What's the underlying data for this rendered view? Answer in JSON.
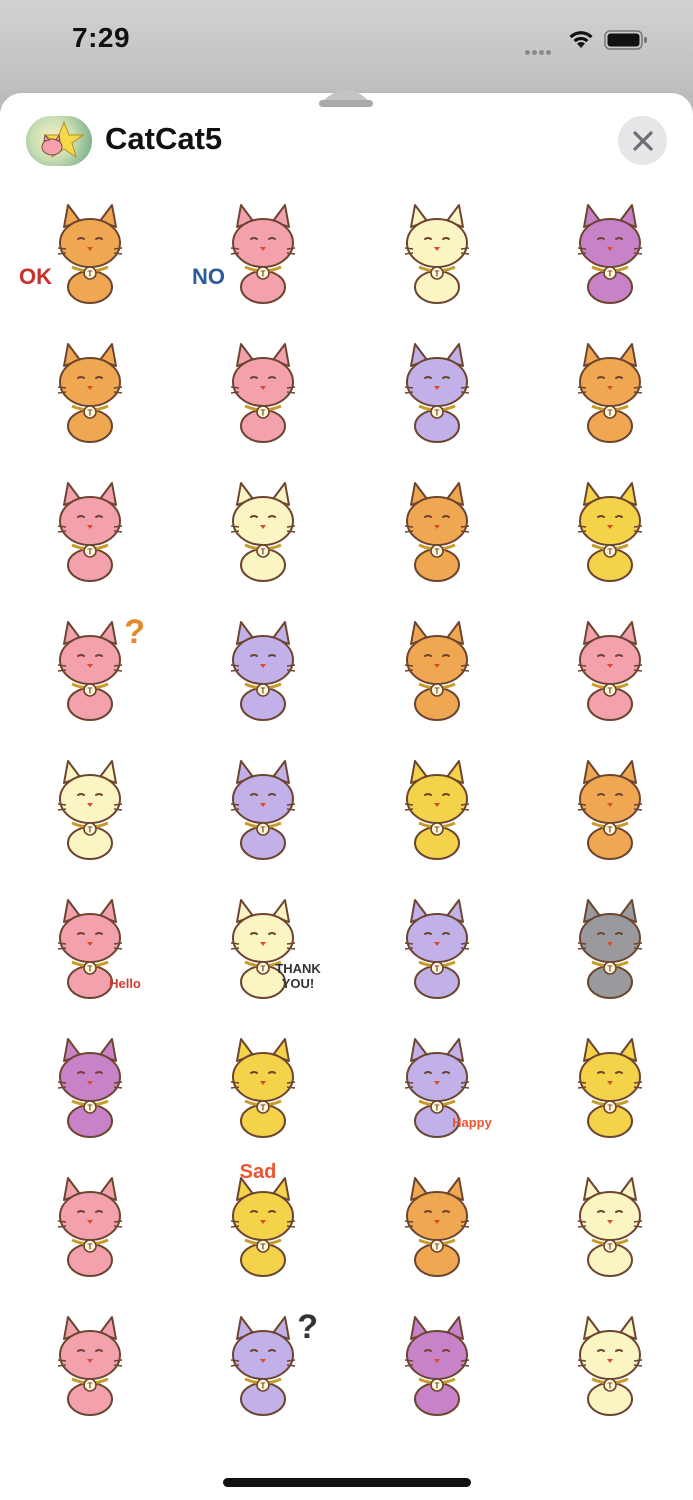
{
  "status_bar": {
    "time": "7:29"
  },
  "sheet": {
    "title": "CatCat5",
    "close_label": "close"
  },
  "colors": {
    "orange": "#f0a752",
    "pink": "#f2a1ad",
    "cream": "#fbf4c3",
    "purple": "#c883c8",
    "lavender": "#c2b1e8",
    "yellow": "#f4d24a",
    "grey": "#9a9a9e"
  },
  "stickers": [
    {
      "cat": "orange",
      "label": "OK",
      "label_color": "#c8302c"
    },
    {
      "cat": "pink",
      "label": "NO",
      "label_color": "#2d5b9a"
    },
    {
      "cat": "cream",
      "label": "",
      "label_color": ""
    },
    {
      "cat": "purple",
      "label": "",
      "label_color": ""
    },
    {
      "cat": "orange",
      "label": "",
      "label_color": ""
    },
    {
      "cat": "pink",
      "label": "",
      "label_color": ""
    },
    {
      "cat": "lavender",
      "label": "",
      "label_color": ""
    },
    {
      "cat": "orange",
      "label": "",
      "label_color": ""
    },
    {
      "cat": "pink",
      "label": "",
      "label_color": ""
    },
    {
      "cat": "cream",
      "label": "",
      "label_color": ""
    },
    {
      "cat": "orange",
      "label": "",
      "label_color": ""
    },
    {
      "cat": "yellow",
      "label": "",
      "label_color": ""
    },
    {
      "cat": "pink",
      "label": "?",
      "label_color": "#e58a2b"
    },
    {
      "cat": "lavender",
      "label": "",
      "label_color": ""
    },
    {
      "cat": "orange",
      "label": "",
      "label_color": ""
    },
    {
      "cat": "pink",
      "label": "",
      "label_color": ""
    },
    {
      "cat": "cream",
      "label": "",
      "label_color": ""
    },
    {
      "cat": "lavender",
      "label": "",
      "label_color": ""
    },
    {
      "cat": "yellow",
      "label": "",
      "label_color": ""
    },
    {
      "cat": "orange",
      "label": "",
      "label_color": ""
    },
    {
      "cat": "pink",
      "label": "Hello",
      "label_color": "#d33a2f"
    },
    {
      "cat": "cream",
      "label": "THANK YOU!",
      "label_color": "#333333"
    },
    {
      "cat": "lavender",
      "label": "",
      "label_color": ""
    },
    {
      "cat": "grey",
      "label": "",
      "label_color": ""
    },
    {
      "cat": "purple",
      "label": "",
      "label_color": ""
    },
    {
      "cat": "yellow",
      "label": "",
      "label_color": ""
    },
    {
      "cat": "lavender",
      "label": "Happy",
      "label_color": "#f0532e"
    },
    {
      "cat": "yellow",
      "label": "",
      "label_color": ""
    },
    {
      "cat": "pink",
      "label": "",
      "label_color": ""
    },
    {
      "cat": "yellow",
      "label": "Sad",
      "label_color": "#f0532e"
    },
    {
      "cat": "orange",
      "label": "",
      "label_color": ""
    },
    {
      "cat": "cream",
      "label": "",
      "label_color": ""
    },
    {
      "cat": "pink",
      "label": "",
      "label_color": ""
    },
    {
      "cat": "lavender",
      "label": "?",
      "label_color": "#333333"
    },
    {
      "cat": "purple",
      "label": "",
      "label_color": ""
    },
    {
      "cat": "cream",
      "label": "",
      "label_color": ""
    }
  ]
}
